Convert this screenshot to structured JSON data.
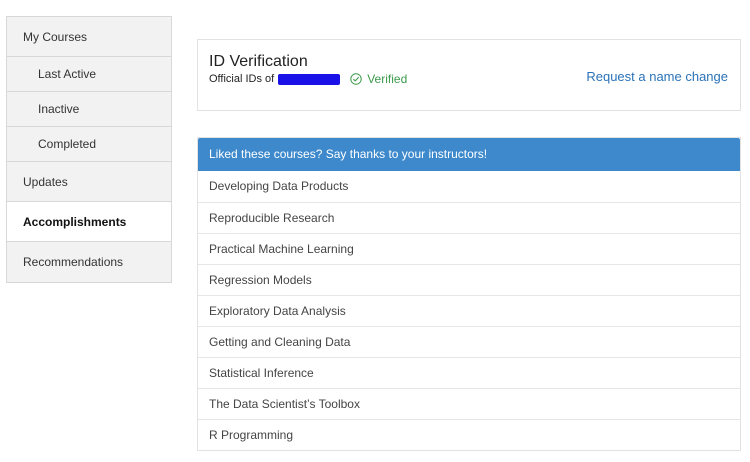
{
  "sidebar": {
    "items": [
      {
        "label": "My Courses"
      },
      {
        "label": "Last Active"
      },
      {
        "label": "Inactive"
      },
      {
        "label": "Completed"
      },
      {
        "label": "Updates"
      },
      {
        "label": "Accomplishments"
      },
      {
        "label": "Recommendations"
      }
    ]
  },
  "verification": {
    "title": "ID Verification",
    "subtitle": "Official IDs of",
    "status": "Verified",
    "request_link": "Request a name change"
  },
  "courses": {
    "header": "Liked these courses? Say thanks to your instructors!",
    "items": [
      "Developing Data Products",
      "Reproducible Research",
      "Practical Machine Learning",
      "Regression Models",
      "Exploratory Data Analysis",
      "Getting and Cleaning Data",
      "Statistical Inference",
      "The Data Scientist’s Toolbox",
      "R Programming"
    ]
  },
  "colors": {
    "accent": "#3d89cc",
    "link": "#2a73b8",
    "verified": "#3c9a4c",
    "redaction": "#1a10e8"
  },
  "icons": {
    "verified": "check-circle-icon"
  }
}
